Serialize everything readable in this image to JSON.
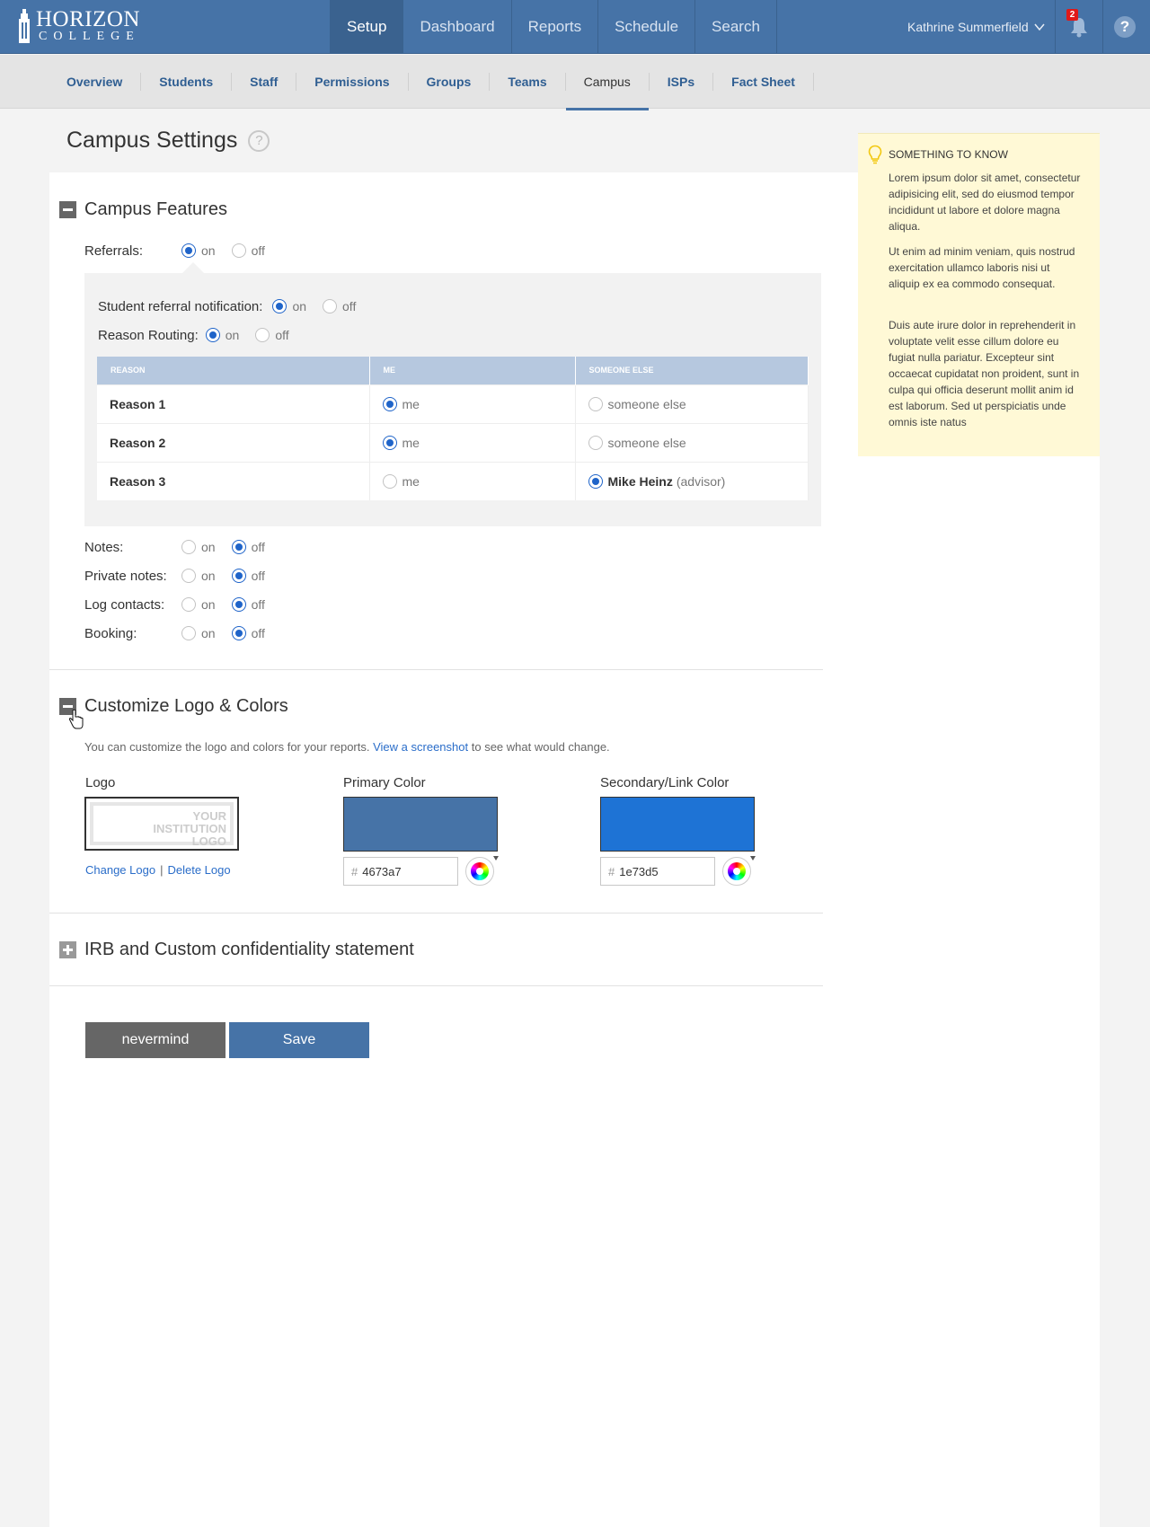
{
  "header": {
    "logo_line1": "HORIZON",
    "logo_line2": "COLLEGE",
    "nav": [
      "Setup",
      "Dashboard",
      "Reports",
      "Schedule",
      "Search"
    ],
    "active_nav": "Setup",
    "user_name": "Kathrine Summerfield",
    "notification_count": "2",
    "help_label": "?"
  },
  "subnav": {
    "items": [
      "Overview",
      "Students",
      "Staff",
      "Permissions",
      "Groups",
      "Teams",
      "Campus",
      "ISPs",
      "Fact Sheet"
    ],
    "active": "Campus"
  },
  "page": {
    "title": "Campus Settings",
    "help_label": "?"
  },
  "campus_features": {
    "title": "Campus Features",
    "referrals_label": "Referrals:",
    "on": "on",
    "off": "off",
    "student_notification_label": "Student referral notification:",
    "reason_routing_label": "Reason Routing:",
    "table_headers": [
      "REASON",
      "ME",
      "SOMEONE ELSE"
    ],
    "reasons": [
      {
        "name": "Reason 1",
        "me": "me",
        "else": "someone else",
        "selected": "me"
      },
      {
        "name": "Reason 2",
        "me": "me",
        "else": "someone else",
        "selected": "me"
      },
      {
        "name": "Reason 3",
        "me": "me",
        "else_name": "Mike Heinz",
        "else_role": "(advisor)",
        "selected": "else"
      }
    ],
    "notes_label": "Notes:",
    "private_notes_label": "Private notes:",
    "log_contacts_label": "Log contacts:",
    "booking_label": "Booking:"
  },
  "customize": {
    "title": "Customize Logo & Colors",
    "desc_before": "You can customize the logo and colors for your reports.",
    "desc_link": "View a screenshot",
    "desc_after": "to see what would change.",
    "logo_label": "Logo",
    "logo_placeholder_1": "YOUR",
    "logo_placeholder_2": "INSTITUTION",
    "logo_placeholder_3": "LOGO",
    "change_logo": "Change Logo",
    "sep": "|",
    "delete_logo": "Delete Logo",
    "primary_label": "Primary Color",
    "primary_hex": "4673a7",
    "primary_color": "#4673a7",
    "secondary_label": "Secondary/Link Color",
    "secondary_hex": "1e73d5",
    "secondary_color": "#1e73d5",
    "hash": "#"
  },
  "irb": {
    "title": "IRB and Custom confidentiality statement"
  },
  "buttons": {
    "cancel": "nevermind",
    "save": "Save"
  },
  "tip": {
    "title": "SOMETHING TO KNOW",
    "p1": "Lorem ipsum dolor sit amet, consectetur adipisicing elit, sed do eiusmod tempor incididunt ut labore et dolore magna aliqua.",
    "p2": " Ut enim ad minim veniam, quis nostrud exercitation ullamco laboris nisi ut aliquip ex ea commodo consequat.",
    "p3": "Duis aute irure dolor in reprehenderit in voluptate velit esse cillum dolore eu fugiat nulla pariatur. Excepteur sint occaecat cupidatat non proident, sunt in culpa qui officia deserunt mollit anim id est laborum. Sed ut perspiciatis unde omnis iste natus"
  }
}
